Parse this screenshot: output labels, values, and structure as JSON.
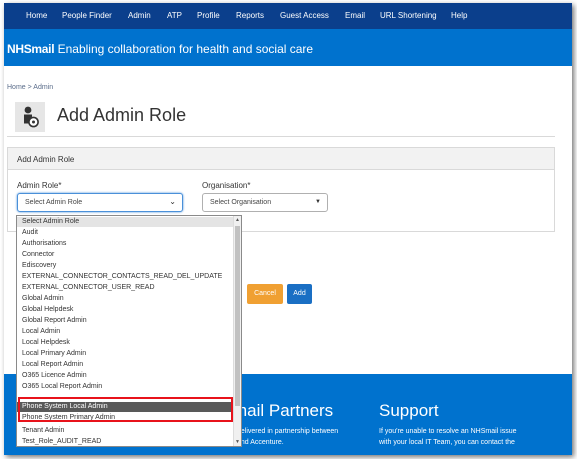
{
  "topnav": {
    "items": [
      "Home",
      "People Finder",
      "Admin",
      "ATP",
      "Profile",
      "Reports",
      "Guest Access",
      "Email",
      "URL Shortening",
      "Help"
    ]
  },
  "header": {
    "brand": "NHSmail",
    "tagline": "Enabling collaboration for health and social care"
  },
  "breadcrumb": {
    "home": "Home",
    "separator": ">",
    "current": "Admin"
  },
  "page": {
    "title": "Add Admin Role",
    "icon": "user-admin-icon"
  },
  "panel": {
    "heading": "Add Admin Role",
    "admin_role_label": "Admin Role*",
    "admin_role_value": "Select Admin Role",
    "organisation_label": "Organisation*",
    "organisation_value": "Select Organisation"
  },
  "buttons": {
    "cancel": "Cancel",
    "add": "Add"
  },
  "dropdown": {
    "options": [
      "Select Admin Role",
      "Audit",
      "Authorisations",
      "Connector",
      "Ediscovery",
      "EXTERNAL_CONNECTOR_CONTACTS_READ_DEL_UPDATE",
      "EXTERNAL_CONNECTOR_USER_READ",
      "Global Admin",
      "Global Helpdesk",
      "Global Report Admin",
      "Local Admin",
      "Local Helpdesk",
      "Local Primary Admin",
      "Local Report Admin",
      "O365 Licence Admin",
      "O365 Local Report Admin",
      "Phone System Local Admin",
      "Phone System Primary Admin",
      "Tenant Admin",
      "Test_Role_AUDIT_READ"
    ],
    "highlighted": "Phone System Local Admin"
  },
  "footer": {
    "partners_heading": "mail Partners",
    "partners_line1": "delivered in partnership between",
    "partners_line2": "and Accenture.",
    "support_heading": "Support",
    "support_line1": "If you're unable to resolve an NHSmail issue",
    "support_line2": "with your local IT Team, you can contact the"
  },
  "colors": {
    "nav_bg": "#0b3f8c",
    "brand_blue": "#0072ce",
    "cancel_orange": "#f0a032",
    "add_blue": "#1a6fc4",
    "highlight_grey": "#595959",
    "annotation_red": "#e8131b"
  }
}
